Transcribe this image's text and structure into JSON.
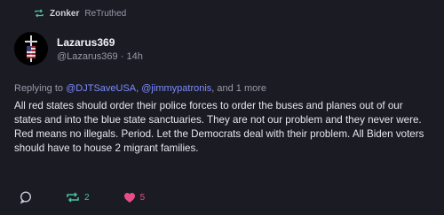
{
  "retruth": {
    "user": "Zonker",
    "action": "ReTruthed"
  },
  "post": {
    "display_name": "Lazarus369",
    "handle": "@Lazarus369",
    "separator": "·",
    "time": "14h",
    "replying_prefix": "Replying to",
    "mention_1": "@DJTSaveUSA",
    "comma": ",",
    "mention_2": "@jimmypatronis",
    "replying_suffix": ", and 1 more",
    "text": "All red states should order their police forces to order the buses and planes out of our states and into the blue state sanctuaries. They are not our problem and they never were. Red means no illegals. Period. Let the Democrats deal with their problem. All Biden voters should have to house 2 migrant families."
  },
  "actions": {
    "retruth_count": "2",
    "like_count": "5"
  },
  "colors": {
    "background": "#1b1b24",
    "retruth_green": "#49c39c",
    "like_pink": "#e84d8a",
    "mention_blue": "#7b8cff"
  },
  "icons": [
    "retruth-icon",
    "avatar-image",
    "reply-icon",
    "retruth-action-icon",
    "heart-icon"
  ]
}
